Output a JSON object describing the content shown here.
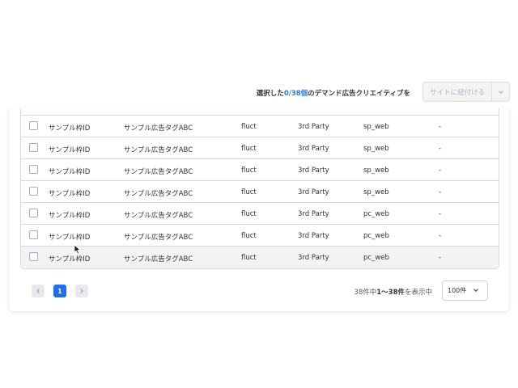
{
  "toolbar": {
    "selection_prefix": "選択した",
    "selection_count": "0/38個",
    "selection_suffix": "のデマンド広告クリエイティブを",
    "assign_button_label": "サイトに紐付ける",
    "dropdown_icon": "chevron-down-icon"
  },
  "table": {
    "rows": [
      {
        "frame_id": "サンプル枠ID",
        "ad_tag": "サンプル広告タグABC",
        "demand": "fluct",
        "party": "3rd Party",
        "platform": "sp_web",
        "extra": "-"
      },
      {
        "frame_id": "サンプル枠ID",
        "ad_tag": "サンプル広告タグABC",
        "demand": "fluct",
        "party": "3rd Party",
        "platform": "sp_web",
        "extra": "-"
      },
      {
        "frame_id": "サンプル枠ID",
        "ad_tag": "サンプル広告タグABC",
        "demand": "fluct",
        "party": "3rd Party",
        "platform": "sp_web",
        "extra": "-"
      },
      {
        "frame_id": "サンプル枠ID",
        "ad_tag": "サンプル広告タグABC",
        "demand": "fluct",
        "party": "3rd Party",
        "platform": "sp_web",
        "extra": "-"
      },
      {
        "frame_id": "サンプル枠ID",
        "ad_tag": "サンプル広告タグABC",
        "demand": "fluct",
        "party": "3rd Party",
        "platform": "pc_web",
        "extra": "-"
      },
      {
        "frame_id": "サンプル枠ID",
        "ad_tag": "サンプル広告タグABC",
        "demand": "fluct",
        "party": "3rd Party",
        "platform": "pc_web",
        "extra": "-"
      },
      {
        "frame_id": "サンプル枠ID",
        "ad_tag": "サンプル広告タグABC",
        "demand": "fluct",
        "party": "3rd Party",
        "platform": "pc_web",
        "extra": "-"
      }
    ]
  },
  "pagination": {
    "current_page": "1",
    "prev_icon": "chevron-left-icon",
    "next_icon": "chevron-right-icon",
    "result_prefix": "38件中",
    "result_range": "1〜38件",
    "result_suffix": "を表示中",
    "per_page_value": "100件"
  },
  "colors": {
    "accent": "#1f6feb",
    "count_link": "#2f7be0"
  }
}
